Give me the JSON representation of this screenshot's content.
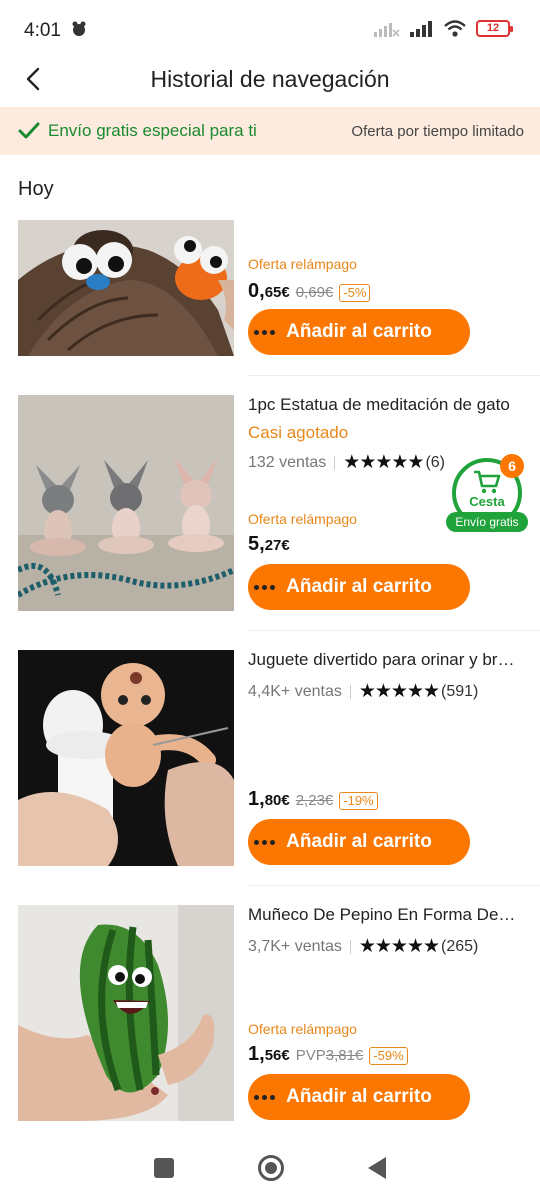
{
  "status_bar": {
    "time": "4:01",
    "battery": "12"
  },
  "header": {
    "title": "Historial de navegación"
  },
  "banner": {
    "left_text": "Envío gratis especial para ti",
    "right_text": "Oferta por tiempo limitado"
  },
  "section": {
    "title": "Hoy"
  },
  "add_label": "Añadir al carrito",
  "products": [
    {
      "flash": "Oferta relámpago",
      "price_int": "0,",
      "price_dec": "65€",
      "old_price": "0,69€",
      "discount": "-5%"
    },
    {
      "title": "1pc Estatua de meditación de gato",
      "stock": "Casi agotado",
      "sales": "132 ventas",
      "stars": "★★★★★",
      "reviews": "(6)",
      "flash": "Oferta relámpago",
      "price_int": "5,",
      "price_dec": "27€"
    },
    {
      "title": "Juguete divertido para orinar y bromear",
      "sales": "4,4K+ ventas",
      "stars": "★★★★★",
      "reviews": "(591)",
      "price_int": "1,",
      "price_dec": "80€",
      "old_price": "2,23€",
      "discount": "-19%"
    },
    {
      "title": "Muñeco De Pepino En Forma De Sandía",
      "sales": "3,7K+ ventas",
      "stars": "★★★★★",
      "reviews": "(265)",
      "flash": "Oferta relámpago",
      "price_int": "1,",
      "price_dec": "56€",
      "pvp_label": "PVP",
      "old_price": "3,81€",
      "discount": "-59%"
    }
  ],
  "cart": {
    "count": "6",
    "label": "Cesta",
    "free": "Envío gratis"
  },
  "colors": {
    "accent": "#fb7701",
    "green": "#1fa33a",
    "banner_bg": "#fdebe0"
  }
}
